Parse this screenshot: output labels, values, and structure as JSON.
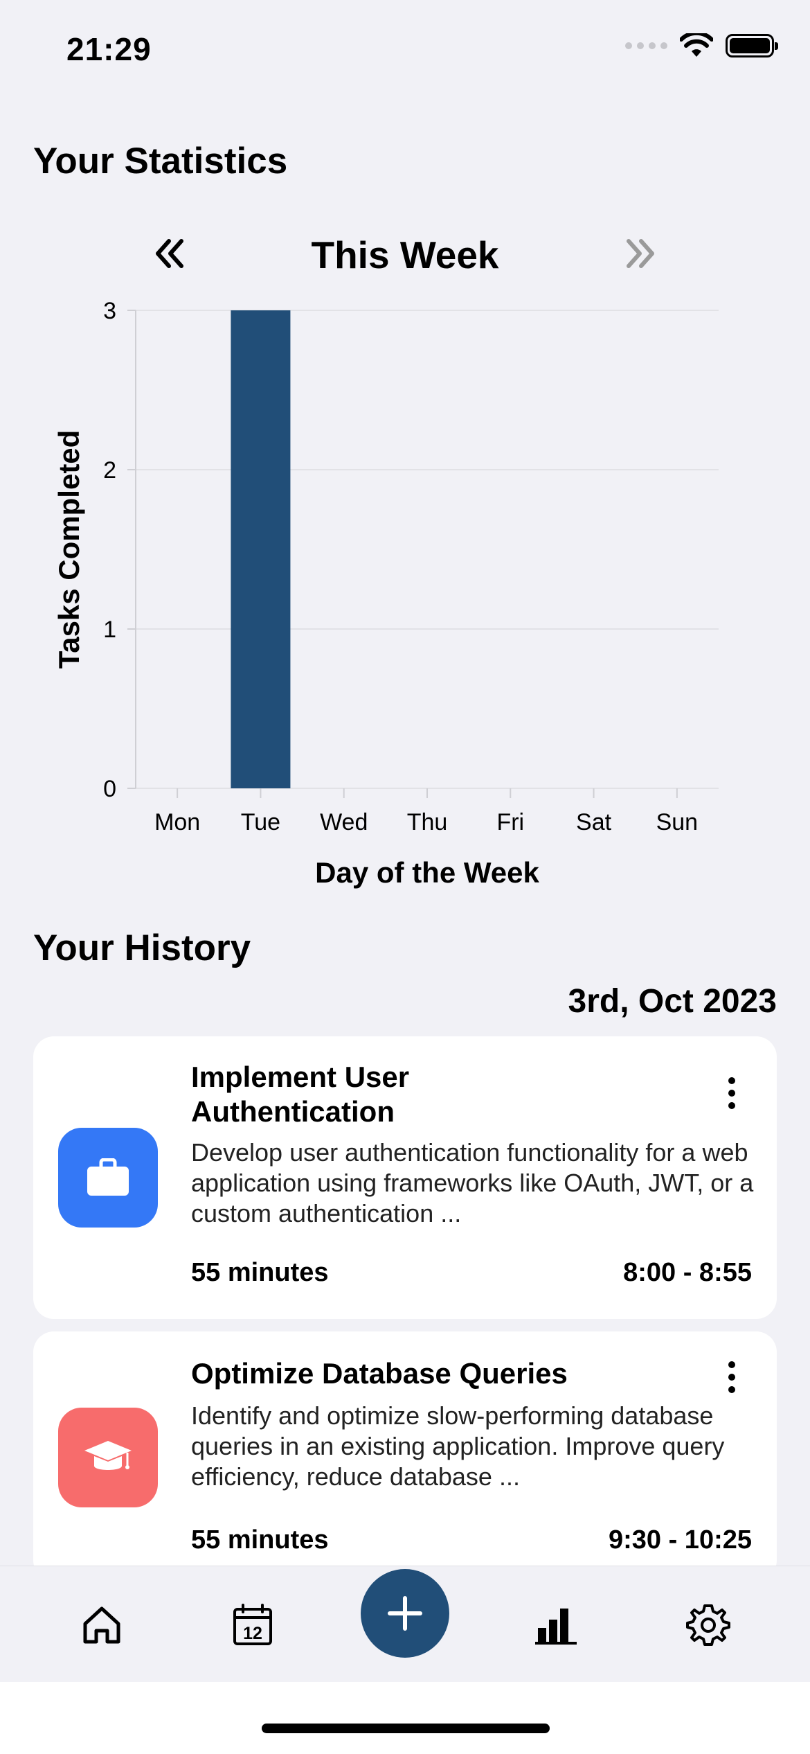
{
  "status": {
    "time": "21:29"
  },
  "statistics": {
    "title": "Your Statistics",
    "week_label": "This Week"
  },
  "chart_data": {
    "type": "bar",
    "categories": [
      "Mon",
      "Tue",
      "Wed",
      "Thu",
      "Fri",
      "Sat",
      "Sun"
    ],
    "values": [
      0,
      3,
      0,
      0,
      0,
      0,
      0
    ],
    "xlabel": "Day of the Week",
    "ylabel": "Tasks Completed",
    "ylim": [
      0,
      3
    ],
    "yticks": [
      0,
      1,
      2,
      3
    ],
    "grid": true,
    "bar_color": "#214e78"
  },
  "history": {
    "title": "Your History",
    "date": "3rd, Oct 2023",
    "items": [
      {
        "title_line1": "Implement User",
        "title_line2": "Authentication",
        "description": "Develop user authentication functionality for a web application using frameworks like OAuth, JWT, or a custom authentication ...",
        "duration": "55 minutes",
        "time": "8:00 - 8:55",
        "icon": "briefcase-icon",
        "color": "#3478f6"
      },
      {
        "title": "Optimize Database Queries",
        "description": "Identify and optimize slow-performing database queries in an existing application. Improve query efficiency, reduce database ...",
        "duration": "55 minutes",
        "time": "9:30 - 10:25",
        "icon": "graduation-cap-icon",
        "color": "#f76c6c"
      }
    ]
  },
  "tab_bar": {
    "items": [
      "home-icon",
      "calendar-icon",
      "add-icon",
      "bar-chart-icon",
      "gear-icon"
    ],
    "calendar_day": "12",
    "accent": "#214e78"
  }
}
